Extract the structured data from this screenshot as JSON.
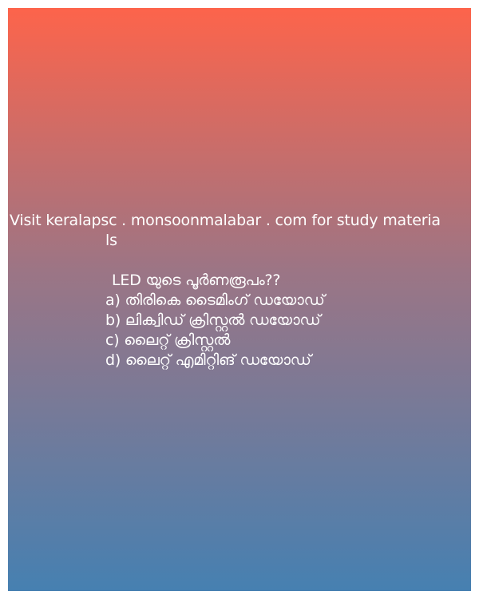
{
  "site": {
    "line1": "Visit keralapsc . monsoonmalabar . com for study materia",
    "line2": "ls"
  },
  "quiz": {
    "question": "LED യുടെ പൂർണരൂപം??",
    "options": [
      "a) തിരികെ ടൈമിംഗ് ഡയോഡ്",
      "b) ലിക്വിഡ് ക്രിസ്റ്റൽ ഡയോഡ്",
      "c) ലൈറ്റ് ക്രിസ്റ്റൽ",
      "d) ലൈറ്റ് എമിറ്റിങ് ഡയോഡ്"
    ]
  },
  "colors": {
    "gradient_top": "#fd644b",
    "gradient_bottom": "#4680b1",
    "text": "#ffffff"
  }
}
